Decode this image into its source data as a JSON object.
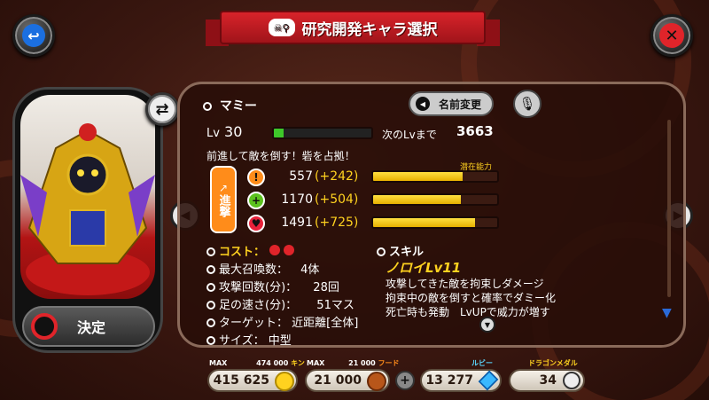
{
  "title": "研究開発キャラ選択",
  "character": {
    "name": "マミー",
    "level_label": "Lv",
    "level": "30",
    "level_progress": 0.1,
    "next_lv_label": "次のLvまで",
    "next_lv_value": "3663",
    "description": "前進して敵を倒す！砦を占拠！",
    "rename_label": "名前変更",
    "advance_label": "進撃",
    "potential_label": "潜在能力"
  },
  "stats": [
    {
      "value": "557",
      "bonus": "(+242)",
      "fill": 0.72,
      "color": "#ff8c1a",
      "icon": "attack-icon"
    },
    {
      "value": "1170",
      "bonus": "(+504)",
      "fill": 0.71,
      "color": "#5cc21e",
      "icon": "defense-icon"
    },
    {
      "value": "1491",
      "bonus": "(+725)",
      "fill": 0.82,
      "color": "#e8223a",
      "icon": "heart-icon"
    }
  ],
  "details": {
    "cost_label": "コスト：",
    "max_summon_label": "最大召喚数：",
    "max_summon_value": "4体",
    "attack_count_label": "攻撃回数(分)：",
    "attack_count_value": "28回",
    "speed_label": "足の速さ(分)：",
    "speed_value": "51マス",
    "target_label": "ターゲット：",
    "target_value": "近距離[全体]",
    "size_label": "サイズ：",
    "size_value": "中型"
  },
  "skill": {
    "header": "スキル",
    "name": "ノロイLv11",
    "line1": "攻撃してきた敵を拘束しダメージ",
    "line2": "拘束中の敵を倒すと確率でダミー化",
    "line3": "死亡時も発動　LvUPで威力が増す"
  },
  "confirm_label": "決定",
  "resources": {
    "coin_max_label": "MAX",
    "coin_max": "474 000",
    "coin_unit": "キン",
    "coin_value": "415 625",
    "food_max_label": "MAX",
    "food_max": "21 000",
    "food_unit": "フード",
    "food_value": "21 000",
    "ruby_label": "ルビー",
    "ruby_value": "13 277",
    "medal_label": "ドラゴンメダル",
    "medal_value": "34"
  },
  "colors": {
    "banner": "#d8232a",
    "bar": "#ffd21f",
    "accent": "#ff8c1a"
  }
}
